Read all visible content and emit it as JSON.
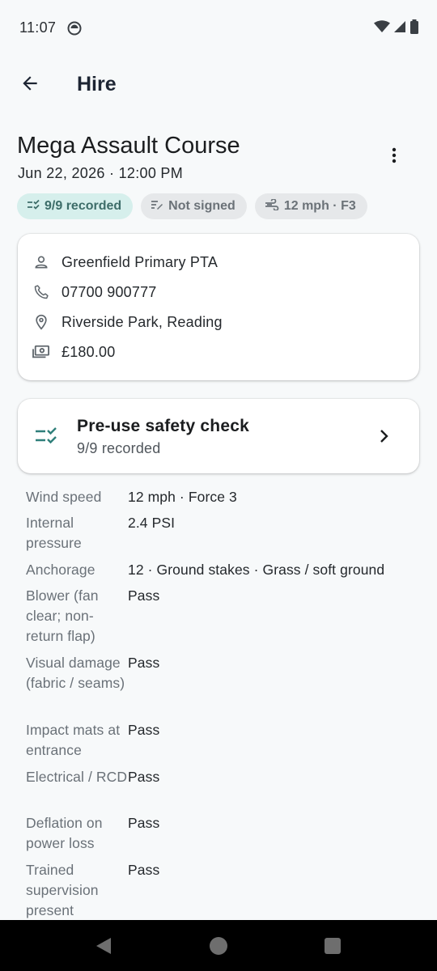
{
  "status_bar": {
    "time": "11:07",
    "icons": [
      "notification-icon",
      "wifi-icon",
      "cell-signal-icon",
      "battery-icon"
    ]
  },
  "app_bar": {
    "title": "Hire",
    "back_icon": "arrow-back-icon"
  },
  "header": {
    "title": "Mega Assault Course",
    "datetime": "Jun 22, 2026 · 12:00 PM",
    "menu_icon": "more-vert-icon"
  },
  "chips": [
    {
      "label": "9/9 recorded",
      "icon": "checklist-icon"
    },
    {
      "label": "Not signed",
      "icon": "signature-icon"
    },
    {
      "label": "12 mph · F3",
      "icon": "wind-icon"
    }
  ],
  "info_card": {
    "contact": "Greenfield Primary PTA",
    "phone": "07700 900777",
    "location": "Riverside Park, Reading",
    "price": "£180.00"
  },
  "safety_check": {
    "title": "Pre-use safety check",
    "subtitle": "9/9 recorded"
  },
  "details": [
    {
      "label": "Wind speed",
      "value": "12 mph · Force 3"
    },
    {
      "label": "Internal pressure",
      "value": "2.4 PSI"
    },
    {
      "label": "Anchorage",
      "value": "12 · Ground stakes · Grass / soft ground"
    },
    {
      "label": "Blower (fan clear; non-return flap)",
      "value": "Pass"
    },
    {
      "label": "Visual damage (fabric / seams)",
      "value": "Pass"
    },
    {
      "label": "Impact mats at entrance",
      "value": "Pass"
    },
    {
      "label": "Electrical / RCD",
      "value": "Pass"
    },
    {
      "label": "Deflation on power loss",
      "value": "Pass"
    },
    {
      "label": "Trained supervision present",
      "value": "Pass"
    }
  ],
  "colors": {
    "background": "#f7f9fa",
    "chip_recorded_bg": "#d6efec",
    "chip_recorded_fg": "#3d6d69",
    "chip_neutral_bg": "#e6e8ea",
    "accent_teal": "#2f7f7a",
    "title_navy": "#1d2533"
  }
}
